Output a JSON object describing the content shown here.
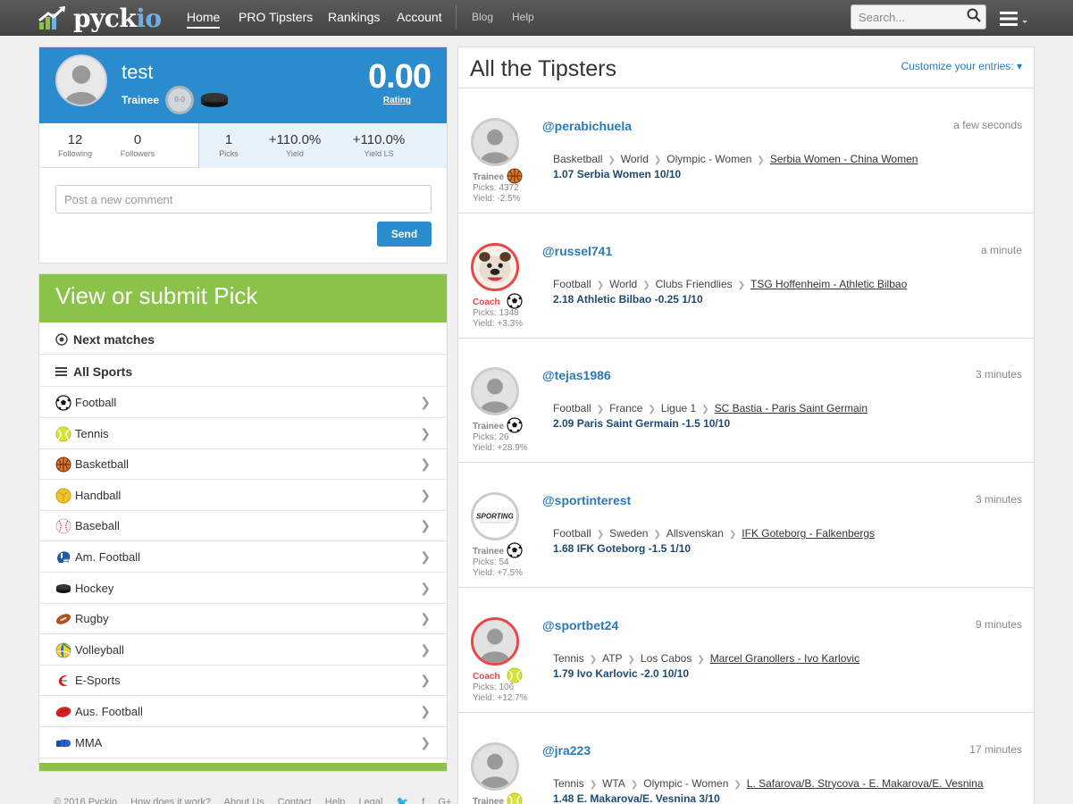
{
  "nav": {
    "logo_main": "pyck",
    "logo_accent": "io",
    "items": [
      "Home",
      "PRO Tipsters",
      "Rankings",
      "Account"
    ],
    "secondary": [
      "Blog",
      "Help"
    ],
    "search_placeholder": "Search..."
  },
  "profile": {
    "name": "test",
    "rank": "Trainee",
    "badge": "0-0",
    "rating_value": "0.00",
    "rating_label": "Rating",
    "stats": [
      {
        "value": "12",
        "label": "Following"
      },
      {
        "value": "0",
        "label": "Followers"
      },
      {
        "value": "1",
        "label": "Picks"
      },
      {
        "value": "+110.0%",
        "label": "Yield"
      },
      {
        "value": "+110.0%",
        "label": "Yield LS"
      }
    ],
    "comment_placeholder": "Post a new comment",
    "send_label": "Send"
  },
  "pick_panel": {
    "title": "View or submit Pick",
    "next_matches": "Next matches",
    "all_sports": "All Sports",
    "sports": [
      "Football",
      "Tennis",
      "Basketball",
      "Handball",
      "Baseball",
      "Am. Football",
      "Hockey",
      "Rugby",
      "Volleyball",
      "E-Sports",
      "Aus. Football",
      "MMA"
    ]
  },
  "footer": [
    "© 2016 Pyckio",
    "How does it work?",
    "About Us",
    "Contact",
    "Help",
    "Legal"
  ],
  "tipsters": {
    "title": "All the Tipsters",
    "customize": "Customize your entries:",
    "rows": [
      {
        "handle": "@perabichuela",
        "time": "a few seconds",
        "rank": "Trainee",
        "sport_icon": "basketball-icon",
        "picks": "Picks: 4372",
        "yield": "Yield: -2.5%",
        "crumbs": [
          "Basketball",
          "World",
          "Olympic - Women"
        ],
        "match": "Serbia Women - China Women",
        "bet": "1.07 Serbia Women   10/10"
      },
      {
        "handle": "@russel741",
        "time": "a minute",
        "rank": "Coach",
        "sport_icon": "football-icon",
        "picks": "Picks: 1348",
        "yield": "Yield: +3.3%",
        "crumbs": [
          "Football",
          "World",
          "Clubs Friendlies"
        ],
        "match": "TSG Hoffenheim - Athletic Bilbao",
        "bet": "2.18 Athletic Bilbao -0.25   1/10"
      },
      {
        "handle": "@tejas1986",
        "time": "3 minutes",
        "rank": "Trainee",
        "sport_icon": "football-icon",
        "picks": "Picks: 26",
        "yield": "Yield: +28.9%",
        "crumbs": [
          "Football",
          "France",
          "Ligue 1"
        ],
        "match": "SC Bastia - Paris Saint Germain",
        "bet": "2.09 Paris Saint Germain -1.5   10/10"
      },
      {
        "handle": "@sportinterest",
        "time": "3 minutes",
        "rank": "Trainee",
        "sport_icon": "football-icon",
        "picks": "Picks: 54",
        "yield": "Yield: +7.5%",
        "crumbs": [
          "Football",
          "Sweden",
          "Allsvenskan"
        ],
        "match": "IFK Goteborg - Falkenbergs",
        "bet": "1.68 IFK Goteborg -1.5   1/10"
      },
      {
        "handle": "@sportbet24",
        "time": "9 minutes",
        "rank": "Coach",
        "sport_icon": "tennis-icon",
        "picks": "Picks: 106",
        "yield": "Yield: +12.7%",
        "crumbs": [
          "Tennis",
          "ATP",
          "Los Cabos"
        ],
        "match": "Marcel Granollers - Ivo Karlovic",
        "bet": "1.79 Ivo Karlovic -2.0   10/10"
      },
      {
        "handle": "@jra223",
        "time": "17 minutes",
        "rank": "Trainee",
        "sport_icon": "tennis-icon",
        "picks": "",
        "yield": "",
        "crumbs": [
          "Tennis",
          "WTA",
          "Olympic - Women"
        ],
        "match": "L. Safarova/B. Strycova - E. Makarova/E. Vesnina",
        "bet": "1.48 E. Makarova/E. Vesnina   3/10"
      }
    ]
  },
  "avatar_sporting_text": "SPORTING"
}
